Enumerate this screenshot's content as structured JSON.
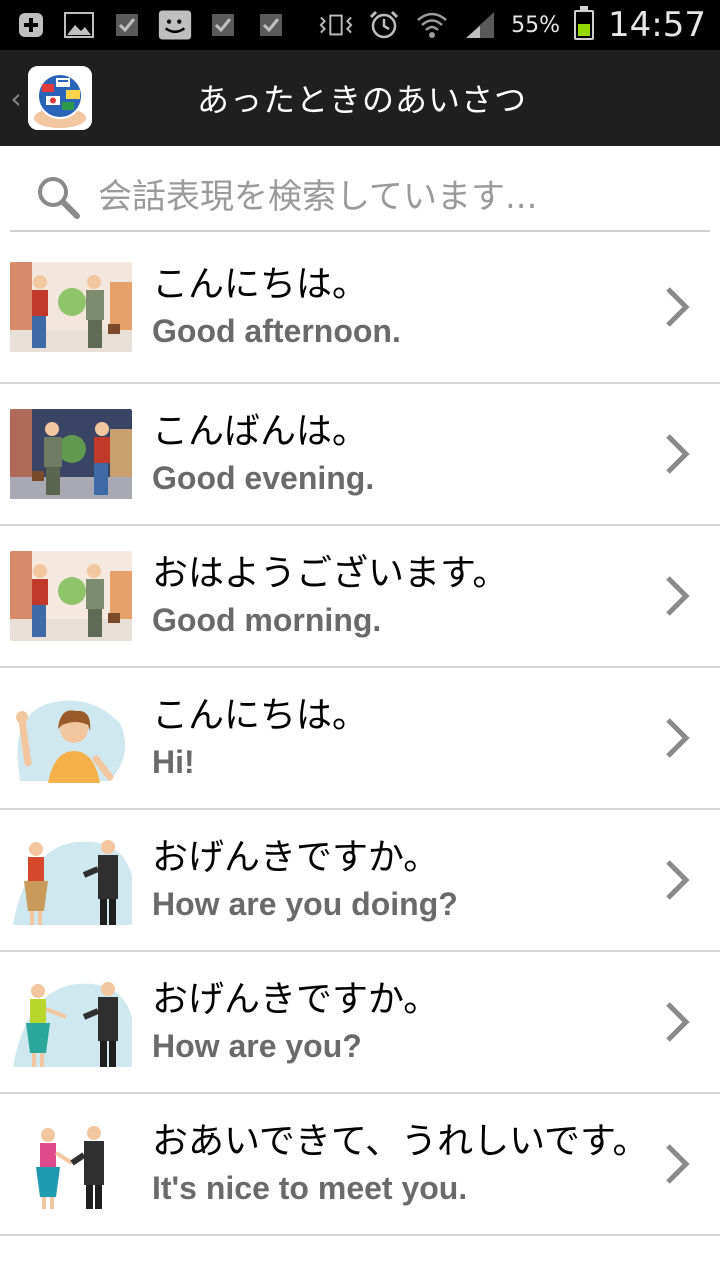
{
  "status": {
    "battery": "55%",
    "battery_level": 0.55,
    "time": "14:57",
    "left_icons": [
      "add-icon",
      "image-icon",
      "checkbox-icon",
      "messaging-icon",
      "checkbox-icon",
      "checkbox-icon"
    ],
    "right_icons": [
      "vibrate-icon",
      "alarm-icon",
      "wifi-icon",
      "signal-icon"
    ]
  },
  "actionbar": {
    "title": "あったときのあいさつ"
  },
  "search": {
    "placeholder": "会話表現を検索しています..."
  },
  "list": {
    "items": [
      {
        "jp": "こんにちは。",
        "en": "Good afternoon."
      },
      {
        "jp": "こんばんは。",
        "en": "Good evening."
      },
      {
        "jp": "おはようございます。",
        "en": "Good morning."
      },
      {
        "jp": "こんにちは。",
        "en": "Hi!"
      },
      {
        "jp": "おげんきですか。",
        "en": "How are you doing?"
      },
      {
        "jp": "おげんきですか。",
        "en": "How are you?"
      },
      {
        "jp": "おあいできて、うれしいです。",
        "en": "It's nice to meet you."
      }
    ]
  },
  "colors": {
    "actionbar_bg": "#1f1f1f",
    "statusbar_bg": "#000000",
    "divider": "#d6d6d6",
    "en_text": "#6a6a6a",
    "chevron": "#8a8a8a",
    "battery_fill": "#94d800"
  }
}
